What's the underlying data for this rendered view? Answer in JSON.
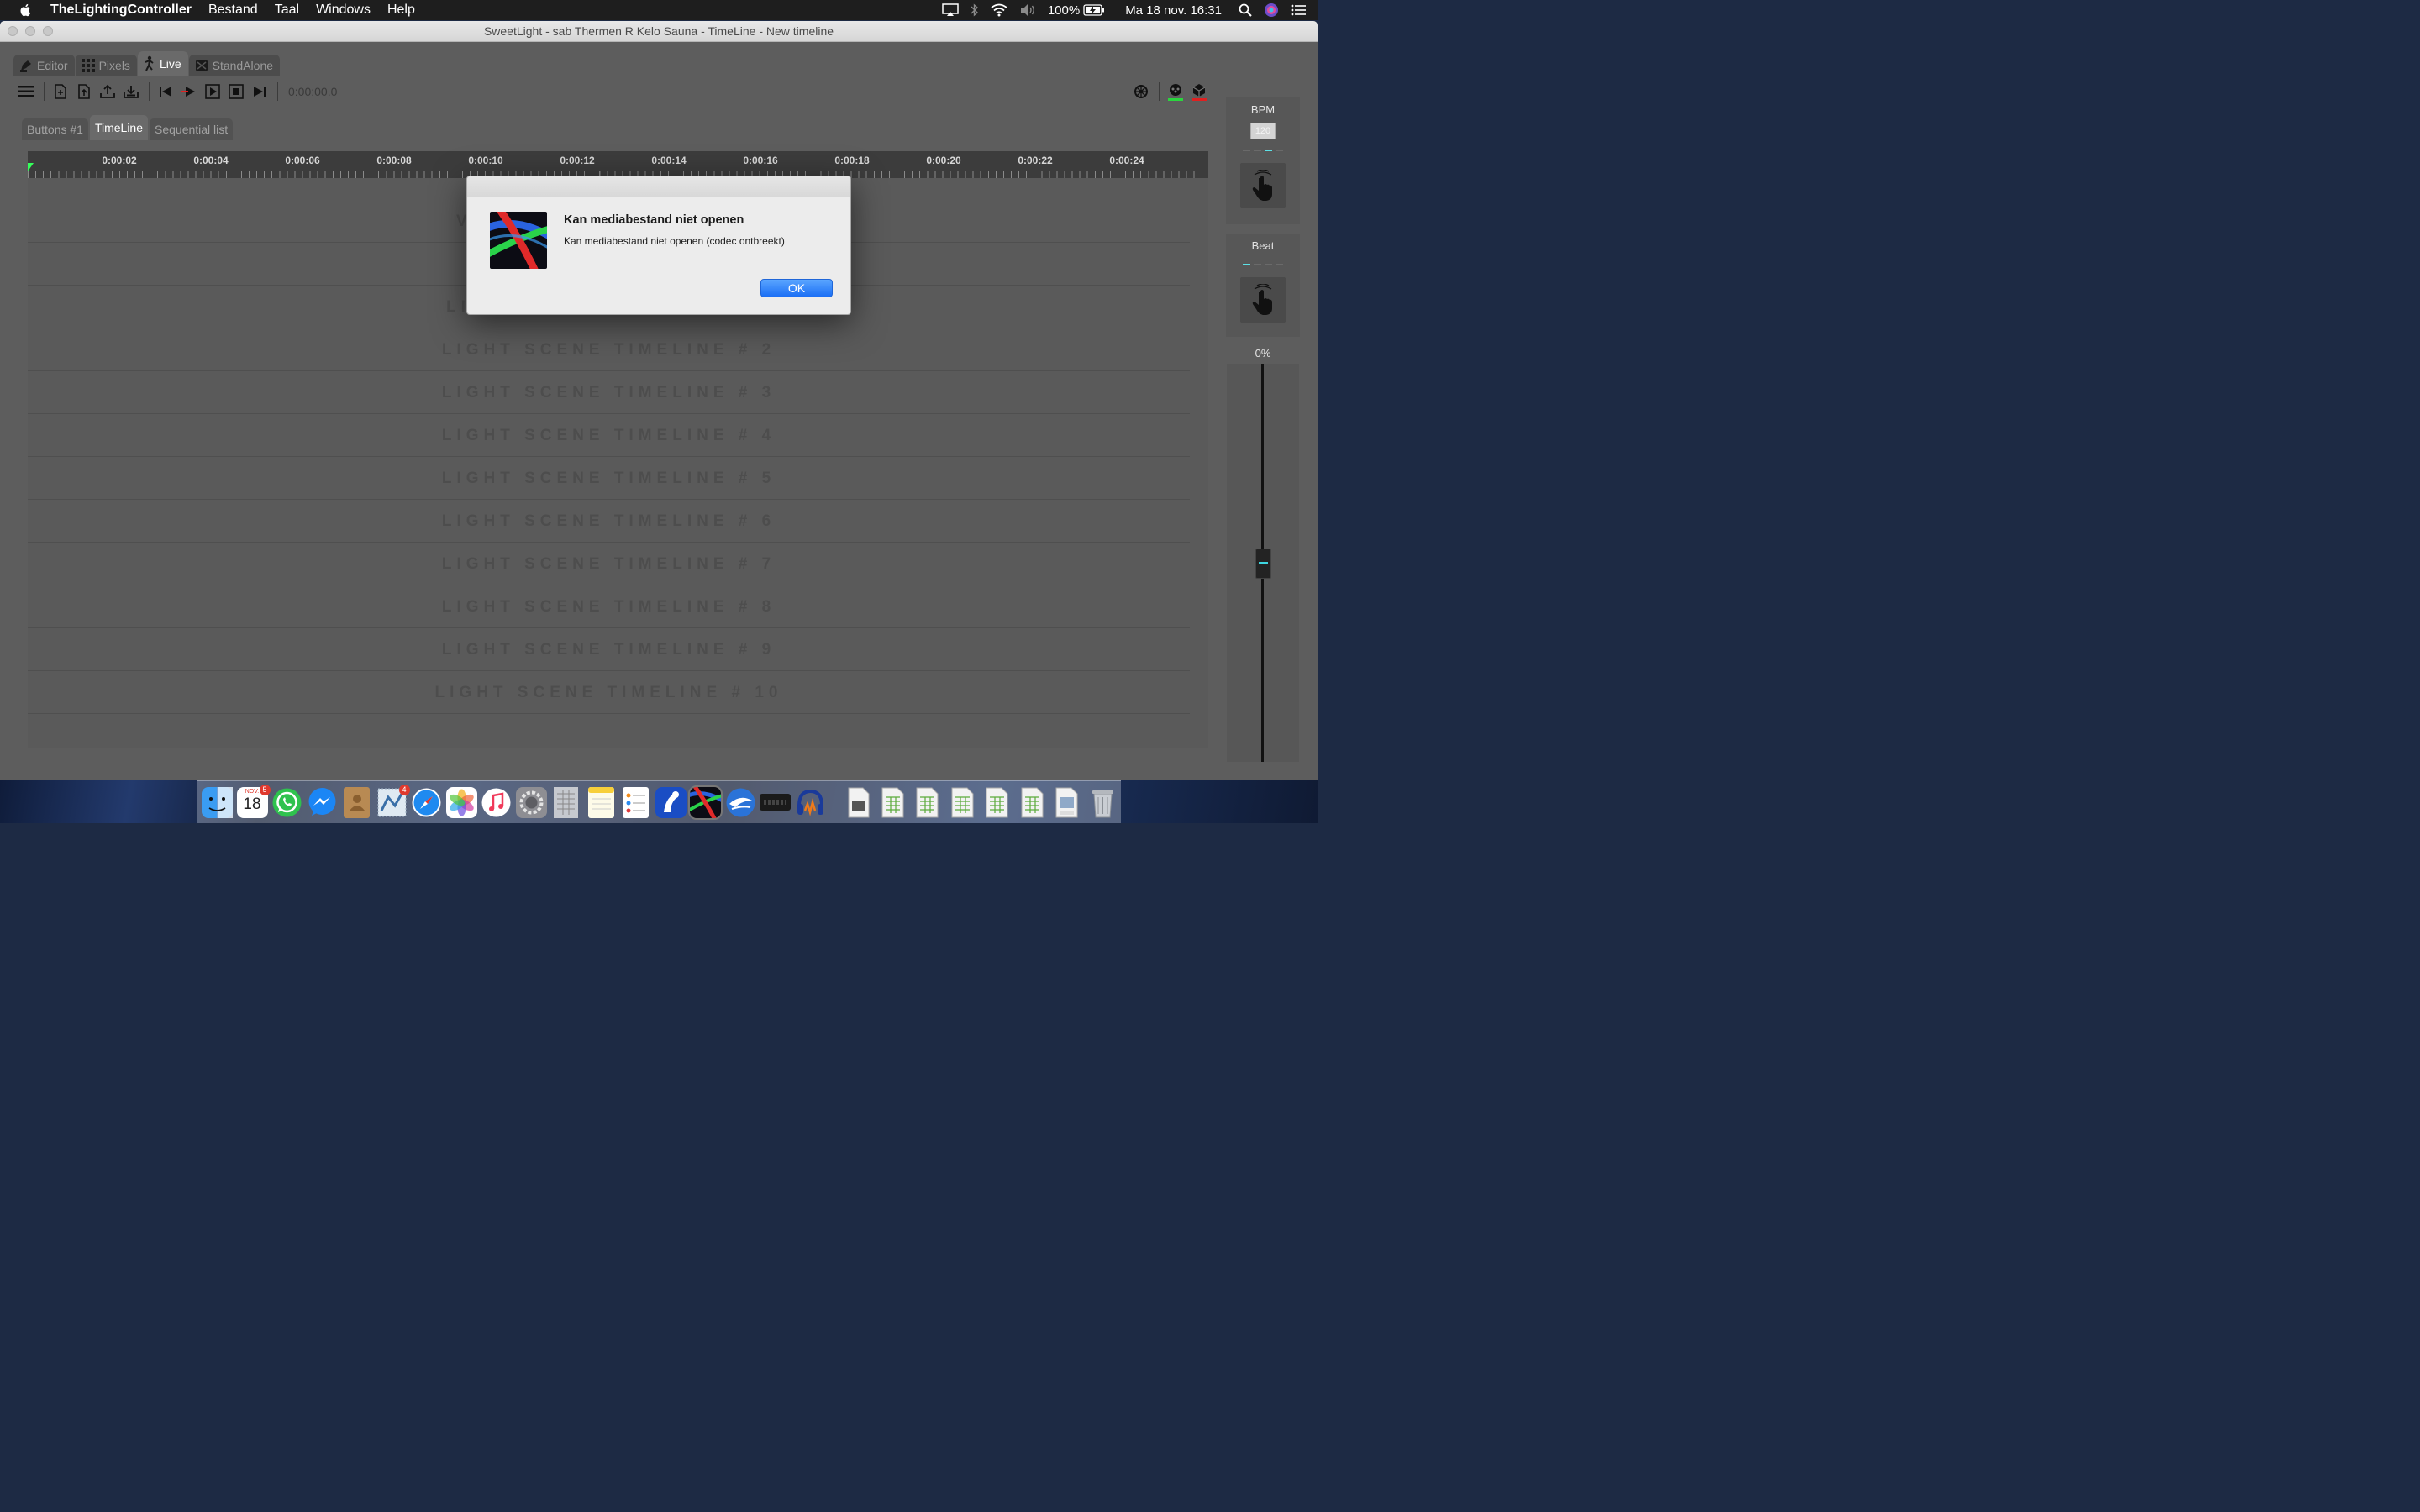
{
  "menubar": {
    "app_name": "TheLightingController",
    "menus": [
      "Bestand",
      "Taal",
      "Windows",
      "Help"
    ],
    "battery": "100%",
    "datetime": "Ma 18 nov.  16:31"
  },
  "window": {
    "title": "SweetLight - sab Thermen R Kelo Sauna - TimeLine - New timeline"
  },
  "mode_tabs": [
    {
      "label": "Editor",
      "icon": "editor-icon"
    },
    {
      "label": "Pixels",
      "icon": "pixels-icon"
    },
    {
      "label": "Live",
      "icon": "live-icon",
      "active": true
    },
    {
      "label": "StandAlone",
      "icon": "standalone-icon"
    }
  ],
  "toolbar": {
    "timecode": "0:00:00.0"
  },
  "sub_tabs": [
    {
      "label": "Buttons #1"
    },
    {
      "label": "TimeLine",
      "active": true
    },
    {
      "label": "Sequential list"
    }
  ],
  "timeline": {
    "ruler_labels": [
      "0:00:02",
      "0:00:04",
      "0:00:06",
      "0:00:08",
      "0:00:10",
      "0:00:12",
      "0:00:14",
      "0:00:16",
      "0:00:18",
      "0:00:20",
      "0:00:22",
      "0:00:24"
    ],
    "tracks": [
      "V",
      "",
      "LI",
      "LIGHT SCENE TIMELINE # 2",
      "LIGHT SCENE TIMELINE # 3",
      "LIGHT SCENE TIMELINE # 4",
      "LIGHT SCENE TIMELINE # 5",
      "LIGHT SCENE TIMELINE # 6",
      "LIGHT SCENE TIMELINE # 7",
      "LIGHT SCENE TIMELINE # 8",
      "LIGHT SCENE TIMELINE # 9",
      "LIGHT SCENE TIMELINE # 10"
    ]
  },
  "right_panel": {
    "bpm_label": "BPM",
    "bpm_value": "120",
    "beat_label": "Beat",
    "fader_value": "0%"
  },
  "dialog": {
    "title": "Kan mediabestand niet openen",
    "message": "Kan mediabestand niet openen (codec ontbreekt)",
    "ok_label": "OK"
  },
  "dock": {
    "calendar_month": "NOV.",
    "calendar_day": "18",
    "calendar_badge": "5",
    "mail_badge": "4"
  },
  "colors": {
    "accent": "#1b6ff5",
    "playhead": "#35ff5a",
    "beat_indicator": "#5de1e6"
  }
}
